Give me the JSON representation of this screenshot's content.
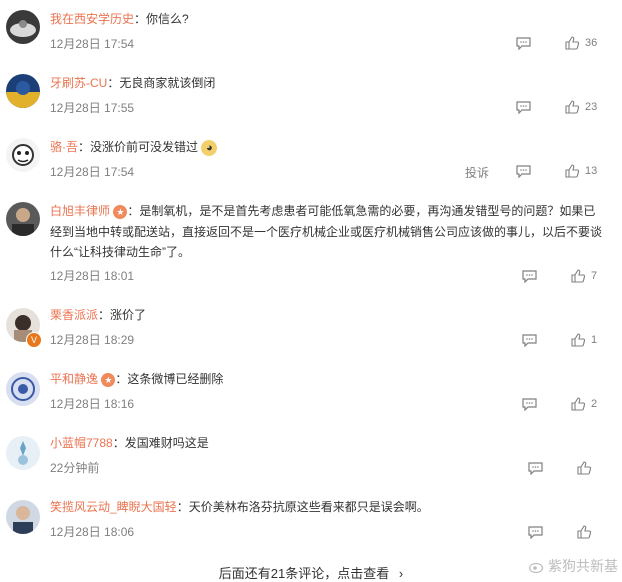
{
  "comments": [
    {
      "user": "我在西安学历史",
      "sep": "：",
      "text": "你信么?",
      "time": "12月28日 17:54",
      "likes": "36"
    },
    {
      "user": "牙刷苏-CU",
      "sep": "：",
      "text": "无良商家就该倒闭",
      "time": "12月28日 17:55",
      "likes": "23"
    },
    {
      "user": "骆·吾",
      "sep": "：",
      "text": "没涨价前可没发错过",
      "time": "12月28日 17:54",
      "likes": "13",
      "report": "投诉"
    },
    {
      "user": "白旭丰律师",
      "sep": "：",
      "text_lines": [
        "是制氧机，是不是首先考虑患者可能低氧急需的必要，再沟通发错型号的问题？如果已",
        "经到当地中转或配送站，直接返回不是一个医疗机械企业或医疗机械销售公司应该做的事儿，以后不要谈",
        "什么“让科技律动生命”了。"
      ],
      "time": "12月28日 18:01",
      "likes": "7"
    },
    {
      "user": "栗香派派",
      "sep": "：",
      "text": "涨价了",
      "time": "12月28日 18:29",
      "likes": "1"
    },
    {
      "user": "平和静逸",
      "sep": "：",
      "text": "这条微博已经删除",
      "time": "12月28日 18:16",
      "likes": "2"
    },
    {
      "user": "小蓝帽7788",
      "sep": "：",
      "text": "发国难财吗这是",
      "time": "22分钟前",
      "likes": ""
    },
    {
      "user": "笑揽风云动_睥睨大国轻",
      "sep": "：",
      "text": "天价美林布洛芬抗原这些看来都只是误会啊。",
      "time": "12月28日 18:06",
      "likes": ""
    }
  ],
  "footer": {
    "more": "后面还有21条评论，点击查看",
    "arrow": "›"
  },
  "watermark": "紫狗共新基",
  "icons": {
    "comment": "comment-icon",
    "like": "thumbs-up-icon",
    "more": "chevron-right-icon"
  },
  "colors": {
    "username": "#eb7350",
    "meta": "#808080",
    "text": "#333333"
  }
}
